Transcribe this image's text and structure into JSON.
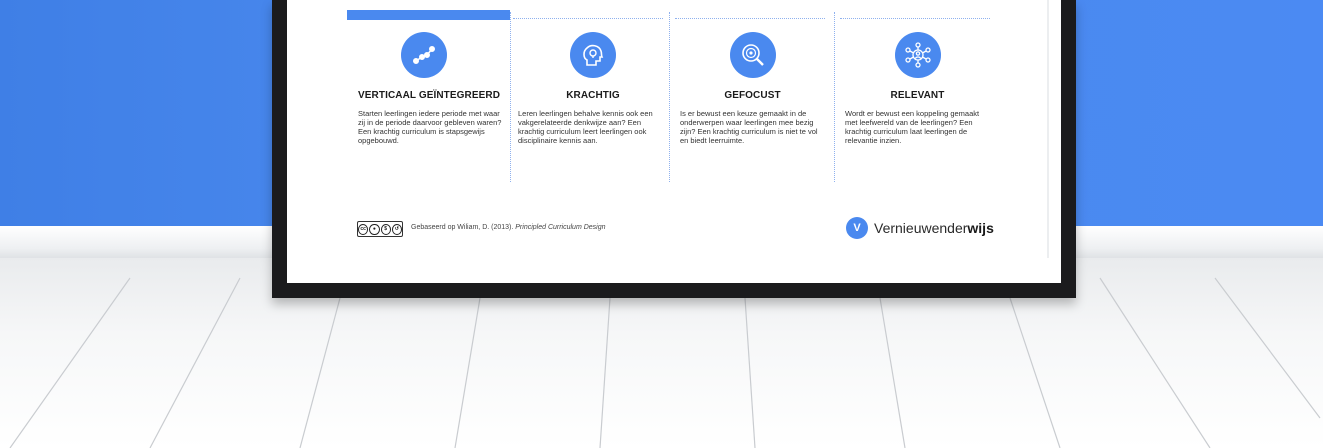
{
  "columns": [
    {
      "title": "VERTICAAL GEÏNTEGREERD",
      "text": "Starten leerlingen iedere periode met waar zij in de periode daarvoor gebleven waren? Een krachtig curriculum is stapsgewijs opgebouwd.",
      "icon": "graph-nodes-icon"
    },
    {
      "title": "KRACHTIG",
      "text": "Leren leerlingen behalve kennis ook een vakgerelateerde denkwijze aan? Een krachtig curriculum leert leerlingen ook disciplinaire kennis aan.",
      "icon": "head-lightbulb-icon"
    },
    {
      "title": "GEFOCUST",
      "text": "Is er bewust een keuze gemaakt in de onderwerpen waar leerlingen mee bezig zijn? Een krachtig curriculum is niet te vol en biedt leerruimte.",
      "icon": "magnifier-target-icon"
    },
    {
      "title": "RELEVANT",
      "text": "Wordt er bewust een koppeling gemaakt met leefwereld van de leerlingen? Een krachtig curriculum laat leerlingen de relevantie inzien.",
      "icon": "network-people-icon"
    }
  ],
  "footer": {
    "license_badge": "cc",
    "credit_prefix": "Gebaseerd op Wiliam, D. (2013). ",
    "credit_title": "Principled Curriculum Design"
  },
  "brand": {
    "name_regular": "Vernieuwender",
    "name_bold": "wijs"
  },
  "colors": {
    "accent": "#4a89ef",
    "wall": "#4a89ef",
    "frame": "#1b1b1d"
  }
}
